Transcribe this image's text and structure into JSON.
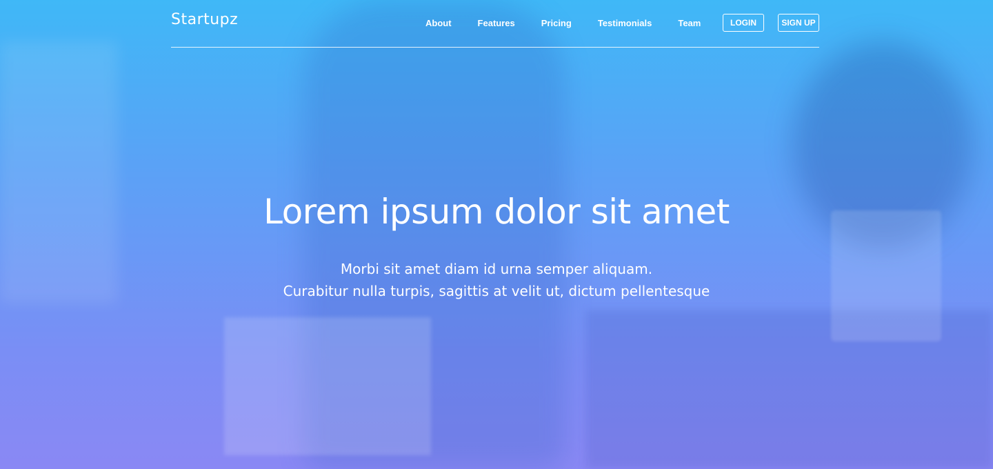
{
  "brand": {
    "name": "Startupz"
  },
  "nav": {
    "links": [
      "About",
      "Features",
      "Pricing",
      "Testimonials",
      "Team"
    ],
    "login_label": "LOGIN",
    "signup_label": "SIGN UP"
  },
  "hero": {
    "headline": "Lorem ipsum dolor sit amet",
    "subtitle_line1": "Morbi sit amet diam id urna semper aliquam.",
    "subtitle_line2": "Curabitur nulla turpis, sagittis at velit ut, dictum pellentesque"
  },
  "colors": {
    "gradient_top": "#3fb8f7",
    "gradient_bottom": "#8a88f4",
    "text": "#ffffff"
  }
}
